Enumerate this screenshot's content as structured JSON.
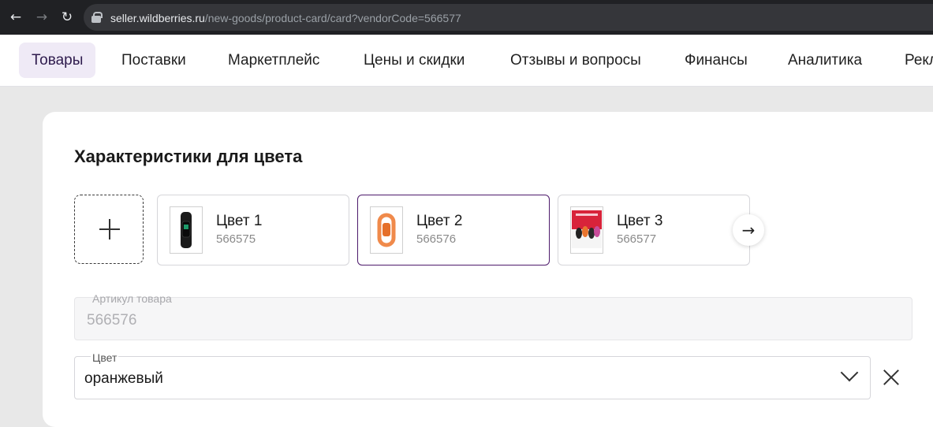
{
  "browser": {
    "back_icon": "arrow-left-icon",
    "forward_icon": "arrow-right-icon",
    "reload_icon": "reload-icon",
    "url_host": "seller.wildberries.ru",
    "url_path": "/new-goods/product-card/card?vendorCode=566577"
  },
  "nav": {
    "items": [
      {
        "label": "Товары",
        "active": true
      },
      {
        "label": "Поставки"
      },
      {
        "label": "Маркетплейс"
      },
      {
        "label": "Цены и скидки"
      },
      {
        "label": "Отзывы и вопросы"
      },
      {
        "label": "Финансы"
      },
      {
        "label": "Аналитика"
      },
      {
        "label": "Рекл"
      }
    ]
  },
  "section": {
    "title": "Характеристики для цвета"
  },
  "colors": [
    {
      "name": "Цвет 1",
      "code": "566575",
      "selected": false,
      "thumb": "black-band"
    },
    {
      "name": "Цвет 2",
      "code": "566576",
      "selected": true,
      "thumb": "orange-band"
    },
    {
      "name": "Цвет 3",
      "code": "566577",
      "selected": false,
      "thumb": "band-collage"
    }
  ],
  "fields": {
    "article_label": "Артикул товара",
    "article_value": "566576",
    "color_label": "Цвет",
    "color_value": "оранжевый"
  },
  "accent": "#4d1a6b"
}
